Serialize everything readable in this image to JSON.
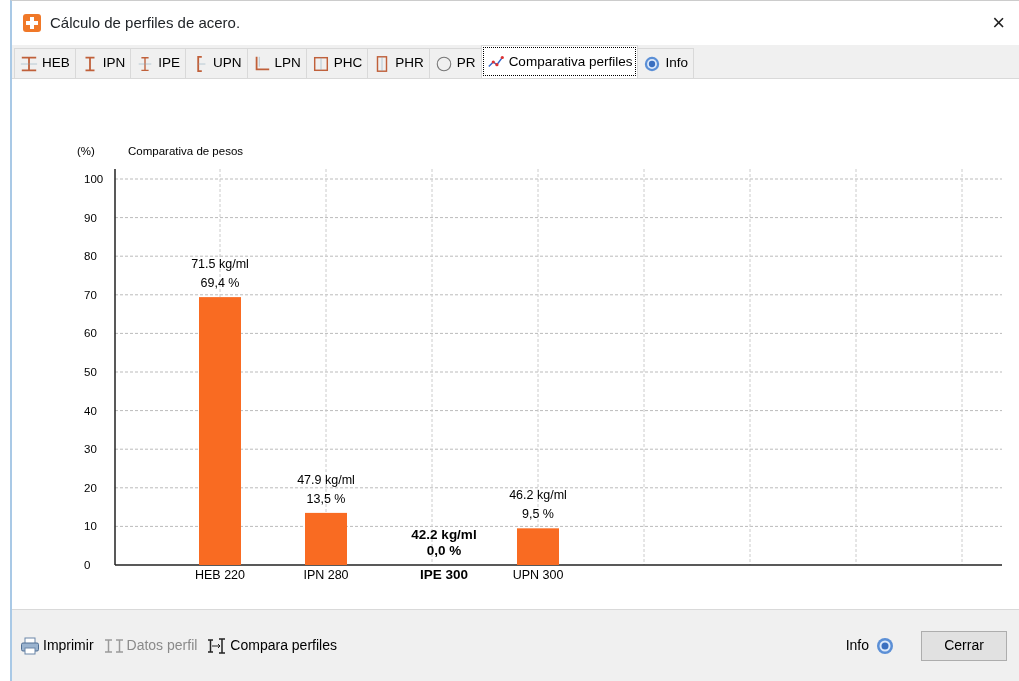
{
  "window": {
    "title": "Cálculo de perfiles de acero.",
    "close": "×"
  },
  "tabs": [
    {
      "label": "HEB",
      "kind": "heb",
      "selected": false
    },
    {
      "label": "IPN",
      "kind": "ipn",
      "selected": false
    },
    {
      "label": "IPE",
      "kind": "ipe",
      "selected": false
    },
    {
      "label": "UPN",
      "kind": "upn",
      "selected": false
    },
    {
      "label": "LPN",
      "kind": "lpn",
      "selected": false
    },
    {
      "label": "PHC",
      "kind": "phc",
      "selected": false
    },
    {
      "label": "PHR",
      "kind": "phr",
      "selected": false
    },
    {
      "label": "PR",
      "kind": "pr",
      "selected": false
    },
    {
      "label": "Comparativa perfiles",
      "kind": "chart",
      "selected": true
    },
    {
      "label": "Info",
      "kind": "info",
      "selected": false
    }
  ],
  "chart_data": {
    "type": "bar",
    "title": "Comparativa de pesos",
    "ylabel": "(%)",
    "categories": [
      "HEB 220",
      "IPN 280",
      "IPE 300",
      "UPN 300"
    ],
    "values": [
      69.4,
      13.5,
      0.0,
      9.5
    ],
    "ylim": [
      0,
      100
    ],
    "yticks": [
      0,
      10,
      20,
      30,
      40,
      50,
      60,
      70,
      80,
      90,
      100
    ],
    "value_labels": [
      "69,4 %",
      "13,5 %",
      "0,0 %",
      "9,5 %"
    ],
    "grid": true,
    "annotations": [
      {
        "text": "71.5 kg/ml"
      },
      {
        "text": "47.9 kg/ml"
      },
      {
        "text": "42.2 kg/ml"
      },
      {
        "text": "46.2 kg/ml"
      }
    ]
  },
  "bars": [
    {
      "reference": false
    },
    {
      "reference": false
    },
    {
      "reference": true
    },
    {
      "reference": false
    }
  ],
  "footer": {
    "actions": [
      {
        "label": "Imprimir",
        "kind": "print",
        "disabled": false
      },
      {
        "label": "Datos perfil",
        "kind": "data",
        "disabled": true
      },
      {
        "label": "Compara perfiles",
        "kind": "compare",
        "disabled": false
      }
    ],
    "info": "Info",
    "close": "Cerrar"
  }
}
